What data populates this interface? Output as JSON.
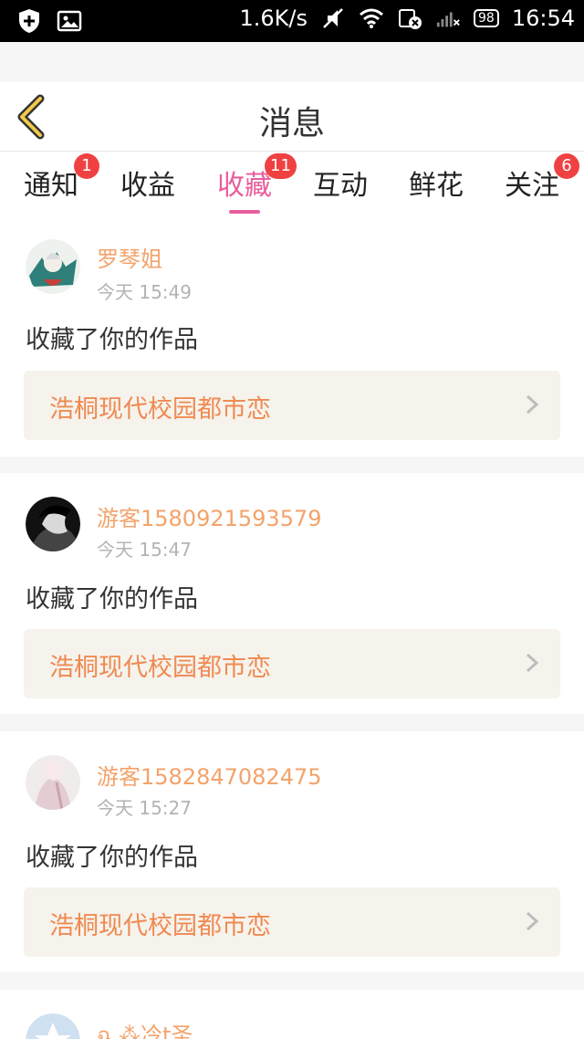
{
  "status": {
    "speed": "1.6K/s",
    "battery": "98",
    "time": "16:54"
  },
  "header": {
    "title": "消息"
  },
  "tabs": [
    {
      "label": "通知",
      "badge": "1"
    },
    {
      "label": "收益",
      "badge": ""
    },
    {
      "label": "收藏",
      "badge": "11",
      "active": true
    },
    {
      "label": "互动",
      "badge": ""
    },
    {
      "label": "鲜花",
      "badge": ""
    },
    {
      "label": "关注",
      "badge": "6"
    }
  ],
  "messages": [
    {
      "user": "罗琴姐",
      "time": "今天 15:49",
      "action": "收藏了你的作品",
      "work": "浩桐现代校园都市恋"
    },
    {
      "user": "游客1580921593579",
      "time": "今天 15:47",
      "action": "收藏了你的作品",
      "work": "浩桐现代校园都市恋"
    },
    {
      "user": "游客1582847082475",
      "time": "今天 15:27",
      "action": "收藏了你的作品",
      "work": "浩桐现代校园都市恋"
    },
    {
      "user": "ฉ ⁂冷t圣",
      "time": "",
      "action": "",
      "work": ""
    }
  ],
  "colors": {
    "accent": "#e85e9c",
    "badge": "#f04142",
    "username": "#f3a36b",
    "work_title": "#f08a52",
    "work_bg": "#f5f3ec"
  }
}
